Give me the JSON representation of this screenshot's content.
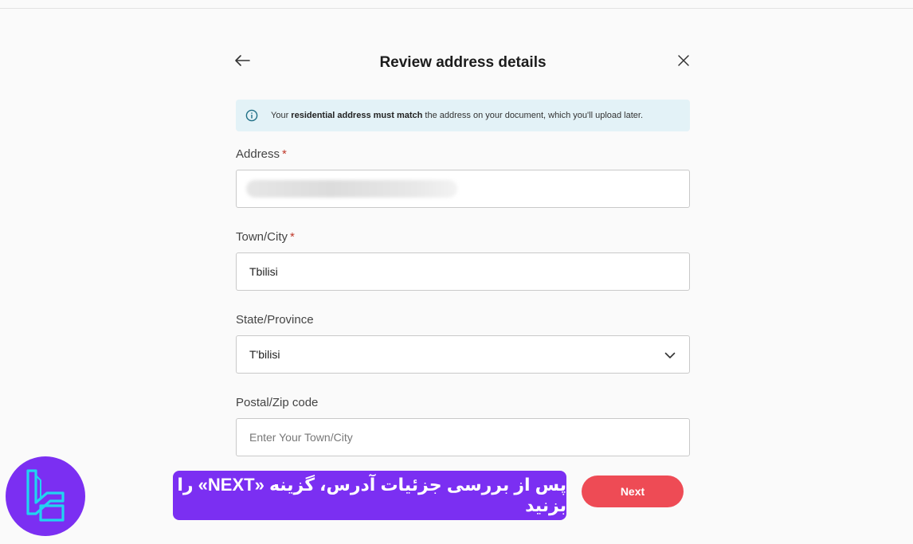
{
  "header": {
    "title": "Review address details",
    "back_icon": "arrow-left-icon",
    "close_icon": "close-icon"
  },
  "notice": {
    "icon": "info-icon",
    "text_prefix": "Your ",
    "text_bold": "residential address must match",
    "text_suffix": " the address on your document, which you'll upload later."
  },
  "form": {
    "address": {
      "label": "Address",
      "required_mark": "*",
      "value": ""
    },
    "city": {
      "label": "Town/City",
      "required_mark": "*",
      "value": "Tbilisi"
    },
    "state": {
      "label": "State/Province",
      "value": "T'bilisi",
      "dropdown_icon": "chevron-down-icon"
    },
    "postal": {
      "label": "Postal/Zip code",
      "placeholder": "Enter Your Town/City"
    }
  },
  "actions": {
    "next_label": "Next"
  },
  "overlay": {
    "caption": "پس از بررسی جزئیات آدرس، گزینه «NEXT» را بزنید",
    "logo": "site-logo"
  },
  "colors": {
    "accent": "#ee4b55",
    "notice_bg": "#e3f2f7",
    "overlay_purple": "#7b2ff2",
    "logo_cyan": "#21d4f0"
  }
}
